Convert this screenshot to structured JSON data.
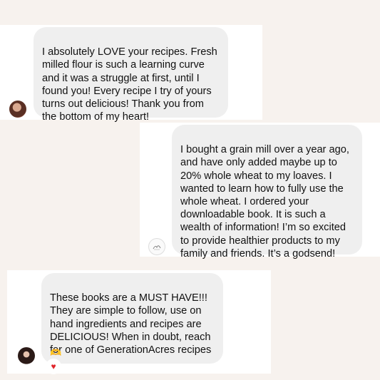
{
  "messages": [
    {
      "id": "msg1",
      "text": "I absolutely LOVE your recipes. Fresh\nmilled flour is such a learning curve\nand it was a struggle at first, until I\nfound you! Every recipe I try of yours\nturns out delicious! Thank you from\nthe bottom of my heart!",
      "avatar": "user-avatar-photo"
    },
    {
      "id": "msg2",
      "text": "I bought a grain mill over a year ago,\nand have only added maybe up to\n20% whole wheat to my loaves. I\nwanted to learn how to fully use the\nwhole wheat. I ordered your\ndownloadable book. It is such a\nwealth of information! I’m so excited\nto provide healthier products to my\nfamily and friends. It’s a godsend!",
      "avatar": "user-avatar-logo"
    },
    {
      "id": "msg3",
      "text": "These books are a MUST HAVE!!!\nThey are simple to follow, use on\nhand ingredients and recipes are\nDELICIOUS! When in doubt, reach\nfor one of GenerationAcres recipes",
      "emoji": "🫶",
      "reaction": "heart",
      "avatar": "user-avatar-photo"
    }
  ],
  "colors": {
    "page_background": "#f7f2ee",
    "card_background": "#ffffff",
    "bubble_background": "#efefef",
    "reaction_heart": "#e0252b"
  }
}
